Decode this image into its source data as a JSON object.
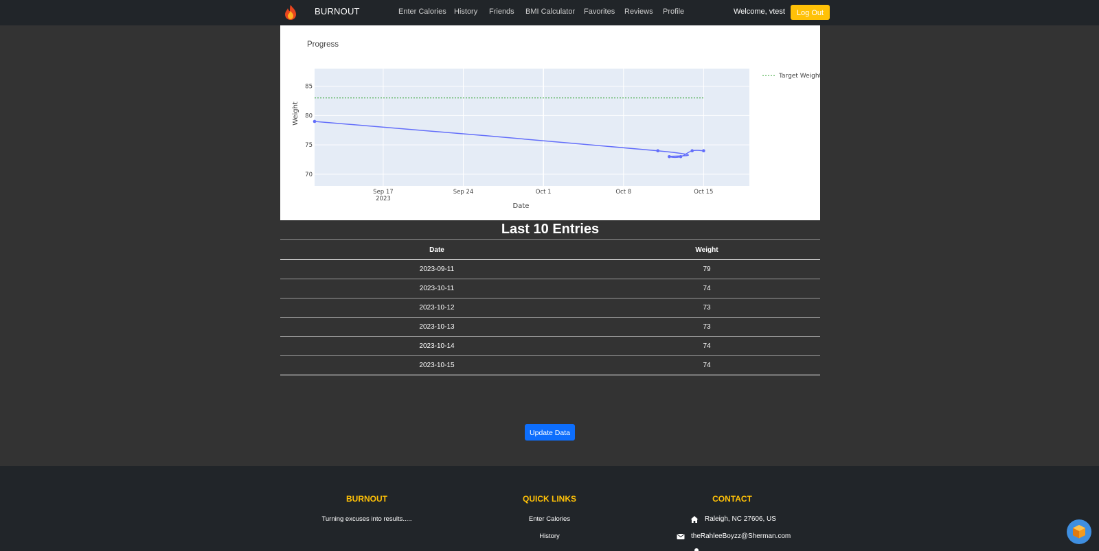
{
  "navbar": {
    "brand": "BURNOUT",
    "brand_icon": "flame-icon",
    "links": [
      "Enter Calories",
      "History",
      "Friends",
      "BMI Calculator",
      "Favorites",
      "Reviews",
      "Profile"
    ],
    "welcome": "Welcome, vtest",
    "logout_label": "Log Out",
    "accent_color": "#ffc107"
  },
  "chart_data": {
    "type": "line",
    "title": "Progress",
    "xlabel": "Date",
    "ylabel": "Weight",
    "x_tick_labels": [
      {
        "line1": "Sep 17",
        "line2": "2023"
      },
      {
        "line1": "Sep 24",
        "line2": ""
      },
      {
        "line1": "Oct 1",
        "line2": ""
      },
      {
        "line1": "Oct 8",
        "line2": ""
      },
      {
        "line1": "Oct 15",
        "line2": ""
      }
    ],
    "y_tick_labels": [
      "70",
      "75",
      "80",
      "85"
    ],
    "xlim": [
      "2023-09-11",
      "2023-10-19"
    ],
    "ylim": [
      68,
      88
    ],
    "legend_position": "top-right",
    "grid": true,
    "series": [
      {
        "name": "",
        "color": "#636efa",
        "x": [
          "2023-09-11",
          "2023-10-11",
          "2023-10-12",
          "2023-10-13",
          "2023-10-14",
          "2023-10-15"
        ],
        "values": [
          79,
          74,
          73,
          73,
          74,
          74
        ]
      },
      {
        "name": "Target Weight",
        "color": "#2ca02c",
        "style": "dotted",
        "x": [
          "2023-09-11",
          "2023-10-15"
        ],
        "values": [
          83,
          83
        ]
      }
    ]
  },
  "entries": {
    "title": "Last 10 Entries",
    "columns": [
      "Date",
      "Weight"
    ],
    "rows": [
      [
        "2023-09-11",
        "79"
      ],
      [
        "2023-10-11",
        "74"
      ],
      [
        "2023-10-12",
        "73"
      ],
      [
        "2023-10-13",
        "73"
      ],
      [
        "2023-10-14",
        "74"
      ],
      [
        "2023-10-15",
        "74"
      ]
    ]
  },
  "update_button": "Update Data",
  "footer": {
    "brand_heading": "BURNOUT",
    "tagline": "Turning excuses into results.....",
    "links_heading": "QUICK LINKS",
    "links": [
      "Enter Calories",
      "History"
    ],
    "contact_heading": "CONTACT",
    "address": "Raleigh, NC 27606, US",
    "email": "theRahleeBoyzz@Sherman.com"
  }
}
